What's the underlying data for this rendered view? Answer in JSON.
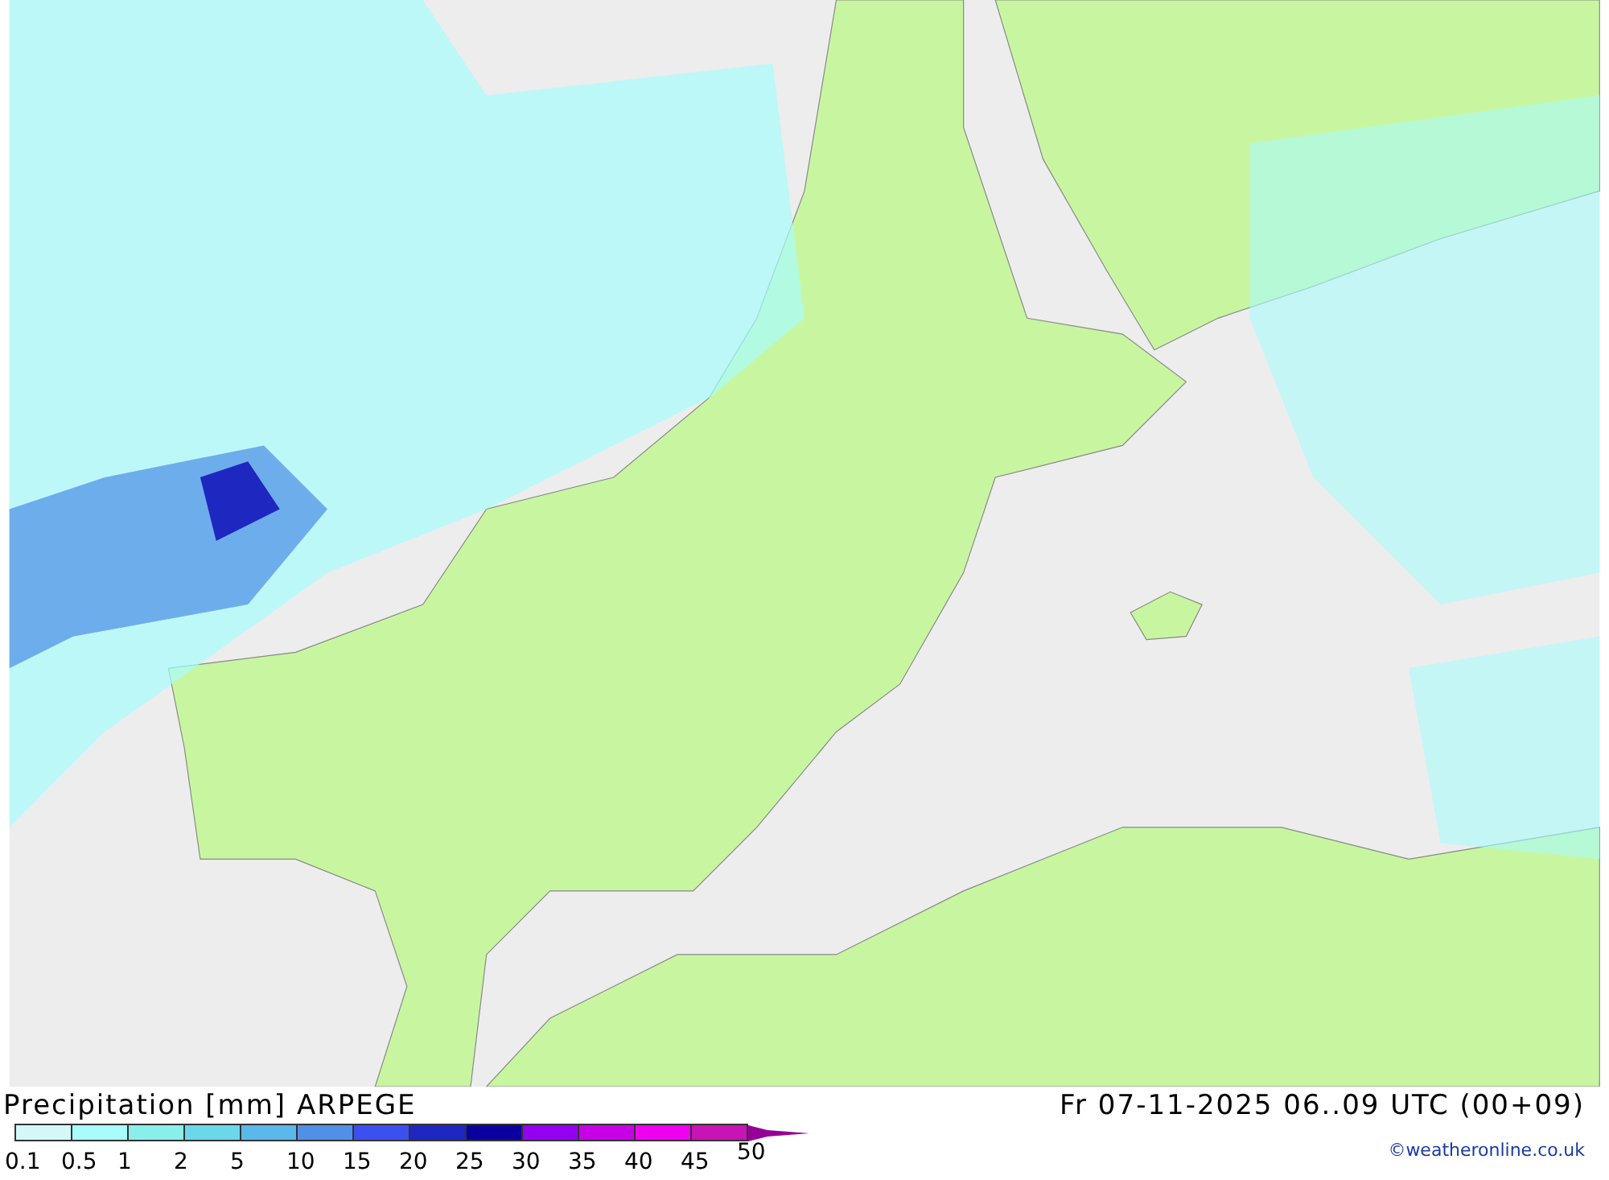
{
  "title": "Precipitation [mm] ARPEGE",
  "valid_time": "Fr 07-11-2025 06..09 UTC (00+09)",
  "scale": [
    {
      "label": "0.1",
      "color": "#d4f8f8"
    },
    {
      "label": "0.5",
      "color": "#a8fcfc"
    },
    {
      "label": "1",
      "color": "#8aeeea"
    },
    {
      "label": "2",
      "color": "#6ad8ea"
    },
    {
      "label": "5",
      "color": "#5ab8ea"
    },
    {
      "label": "10",
      "color": "#5090e6"
    },
    {
      "label": "15",
      "color": "#3c50f0"
    },
    {
      "label": "20",
      "color": "#1e28c0"
    },
    {
      "label": "25",
      "color": "#0a00a0"
    },
    {
      "label": "30",
      "color": "#9600f0"
    },
    {
      "label": "35",
      "color": "#c800e6"
    },
    {
      "label": "40",
      "color": "#f000f0"
    },
    {
      "label": "45",
      "color": "#c814b4"
    }
  ],
  "scale_end": {
    "label": "50",
    "color": "#960096"
  },
  "credit": "©weatheronline.co.uk"
}
